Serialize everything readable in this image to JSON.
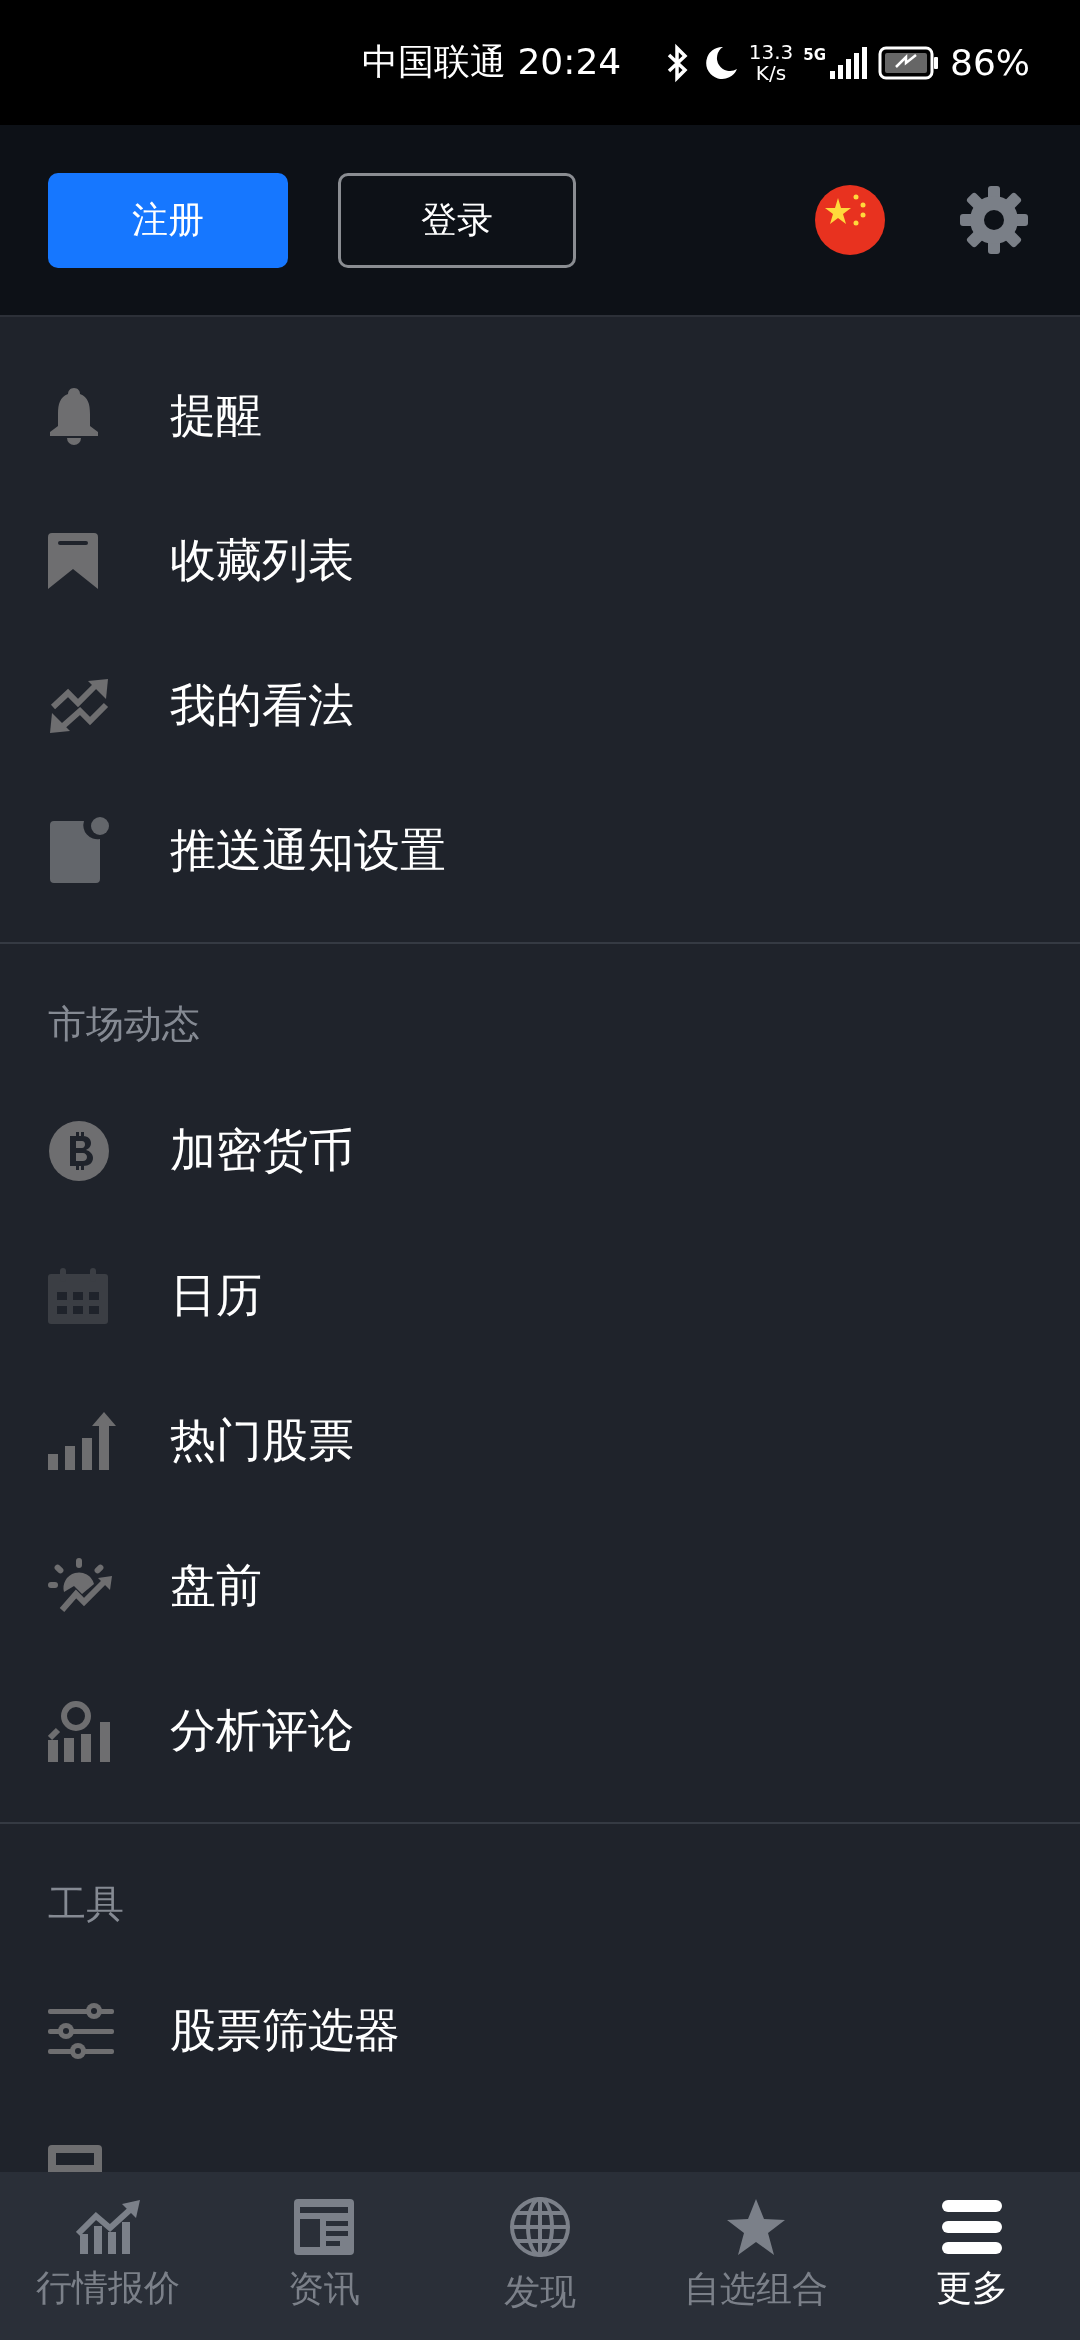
{
  "status_bar": {
    "carrier_time": "中国联通 20:24",
    "speed_value": "13.3",
    "speed_unit": "K/s",
    "network": "5G",
    "battery": "86%"
  },
  "header": {
    "buttons": [
      {
        "label": "注册",
        "kind": "primary"
      },
      {
        "label": "登录",
        "kind": "outline"
      }
    ]
  },
  "sections": [
    {
      "items": [
        {
          "label": "提醒",
          "kind": "bell"
        },
        {
          "label": "收藏列表",
          "kind": "bookmark"
        },
        {
          "label": "我的看法",
          "kind": "trend"
        },
        {
          "label": "推送通知设置",
          "kind": "notify"
        }
      ]
    },
    {
      "title": "市场动态",
      "items": [
        {
          "label": "加密货币",
          "kind": "bitcoin"
        },
        {
          "label": "日历",
          "kind": "calendar"
        },
        {
          "label": "热门股票",
          "kind": "bars"
        },
        {
          "label": "盘前",
          "kind": "sunrise"
        },
        {
          "label": "分析评论",
          "kind": "analysis"
        }
      ]
    },
    {
      "title": "工具",
      "items": [
        {
          "label": "股票筛选器",
          "kind": "sliders"
        },
        {
          "kind": "calculator"
        }
      ]
    }
  ],
  "nav": [
    {
      "label": "行情报价",
      "kind": "chart",
      "selected": false
    },
    {
      "label": "资讯",
      "kind": "news",
      "selected": false
    },
    {
      "label": "发现",
      "kind": "globe",
      "selected": false
    },
    {
      "label": "自选组合",
      "kind": "star",
      "selected": false
    },
    {
      "label": "更多",
      "kind": "menu",
      "selected": true
    }
  ]
}
